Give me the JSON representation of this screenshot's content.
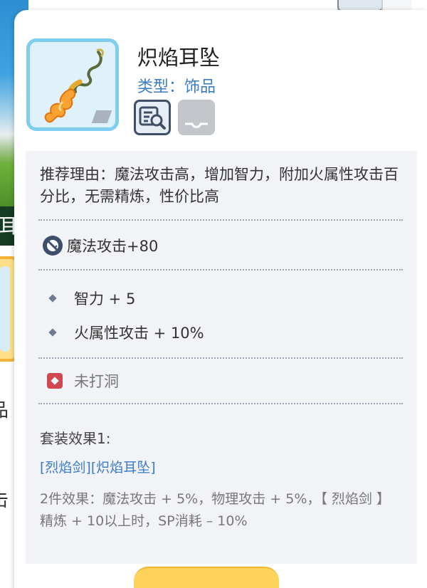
{
  "background": {
    "edge_chars": [
      "耳",
      "品",
      "击"
    ]
  },
  "tooltip": {
    "item_name": "炽焰耳坠",
    "item_type": "类型：饰品",
    "reason": "推荐理由：魔法攻击高，增加智力，附加火属性攻击百分比，无需精炼，性价比高",
    "base_stat": "魔法攻击+80",
    "bonus_stats": [
      "智力 + 5",
      "火属性攻击 + 10%"
    ],
    "socket": "未打洞",
    "set_title": "套装效果1:",
    "set_items": "[烈焰剑][炽焰耳坠]",
    "set_effect": "2件效果：魔法攻击 + 5%，物理攻击 + 5%，【 烈焰剑 】精炼 + 10以上时，SP消耗 – 10%"
  },
  "icons": {
    "item": "flame-earring-icon",
    "inspect": "inspect-magnifier-icon",
    "card": "card-slot-icon",
    "stat": "magic-attack-icon",
    "socket": "socket-icon"
  },
  "colors": {
    "accent_blue": "#3b7bc8",
    "icon_border": "#7fcdef",
    "socket_red": "#d0474f",
    "button_yellow": "#ffd45a"
  }
}
